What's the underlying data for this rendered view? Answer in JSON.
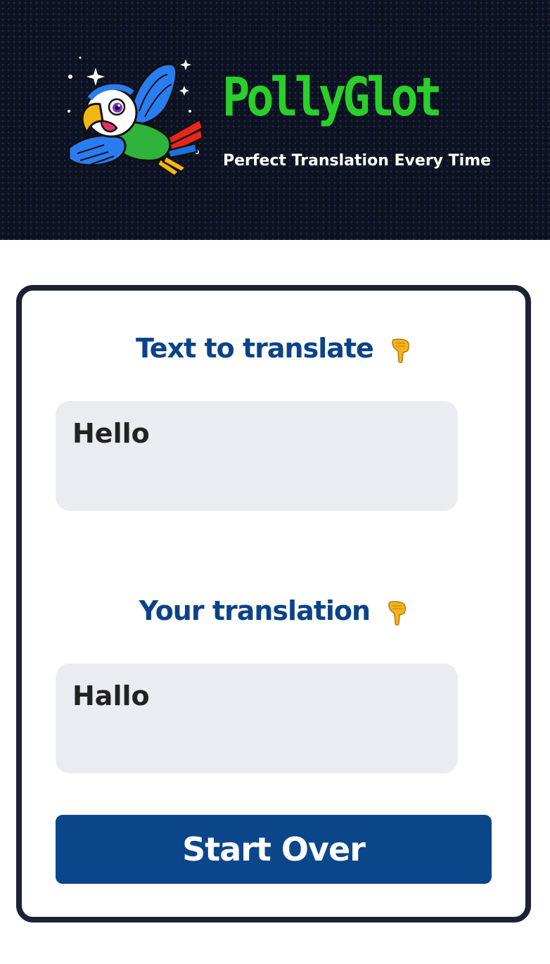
{
  "header": {
    "title": "PollyGlot",
    "subtitle": "Perfect Translation Every Time",
    "logo_icon": "parrot-icon"
  },
  "input_section": {
    "heading": "Text to translate",
    "heading_icon": "pointing-down-icon",
    "text": "Hello"
  },
  "output_section": {
    "heading": "Your translation",
    "heading_icon": "pointing-down-icon",
    "text": "Hallo"
  },
  "actions": {
    "start_over_label": "Start Over"
  },
  "colors": {
    "header_bg": "#0e1220",
    "brand_green": "#2bcf2a",
    "heading_blue": "#0b4389",
    "button_blue": "#0b468b",
    "textbox_bg": "#ebecf1",
    "card_border": "#1b2233"
  }
}
